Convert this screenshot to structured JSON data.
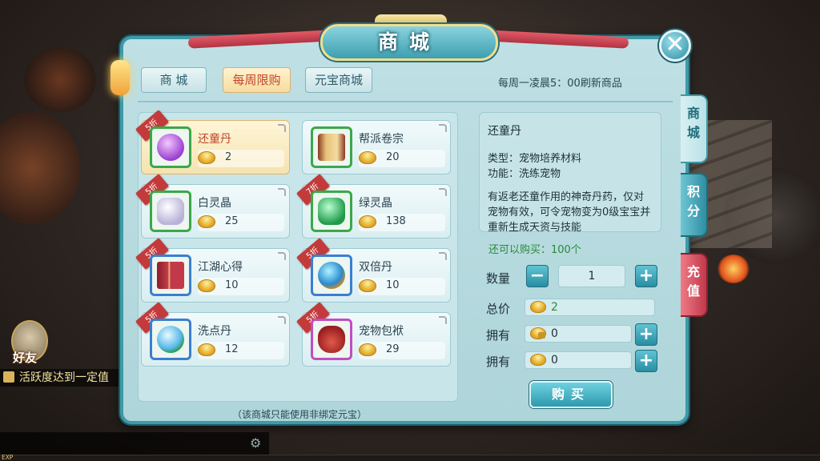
{
  "window": {
    "title": "商城",
    "close_symbol": "✕"
  },
  "tabs": [
    {
      "label": "商 城",
      "active": false
    },
    {
      "label": "每周限购",
      "active": true
    },
    {
      "label": "元宝商城",
      "active": false
    }
  ],
  "refresh_note": "每周一凌晨5：00刷新商品",
  "items": [
    {
      "name": "还童丹",
      "price": "2",
      "badge": "5折",
      "frame": "green",
      "icon": "purple-pill-icon",
      "selected": true
    },
    {
      "name": "帮派卷宗",
      "price": "20",
      "badge": "",
      "frame": "green",
      "icon": "scroll-icon",
      "selected": false
    },
    {
      "name": "白灵晶",
      "price": "25",
      "badge": "5折",
      "frame": "green",
      "icon": "white-crystal-icon",
      "selected": false
    },
    {
      "name": "绿灵晶",
      "price": "138",
      "badge": "7折",
      "frame": "green",
      "icon": "green-crystal-icon",
      "selected": false
    },
    {
      "name": "江湖心得",
      "price": "10",
      "badge": "5折",
      "frame": "blue",
      "icon": "book-icon",
      "selected": false
    },
    {
      "name": "双倍丹",
      "price": "10",
      "badge": "5折",
      "frame": "blue",
      "icon": "orb-icon",
      "selected": false
    },
    {
      "name": "洗点丹",
      "price": "12",
      "badge": "5折",
      "frame": "blue",
      "icon": "swirl-orb-icon",
      "selected": false
    },
    {
      "name": "宠物包袱",
      "price": "29",
      "badge": "5折",
      "frame": "purple",
      "icon": "bag-icon",
      "selected": false
    }
  ],
  "footer_note": "（该商城只能使用非绑定元宝）",
  "detail": {
    "title": "还童丹",
    "type_line": "类型：宠物培养材料",
    "func_line": "功能：洗练宠物",
    "description": "有返老还童作用的神奇丹药，仅对宠物有效，可令宠物变为0级宝宝并重新生成天资与技能"
  },
  "can_buy": "还可以购买：100个",
  "quantity": {
    "label": "数量",
    "value": "1",
    "minus": "−",
    "plus": "+"
  },
  "total": {
    "label": "总价",
    "value": "2"
  },
  "owned_bound": {
    "label": "拥有",
    "value": "0",
    "plus": "+"
  },
  "owned": {
    "label": "拥有",
    "value": "0",
    "plus": "+"
  },
  "buy_label": "购买",
  "side_tabs": {
    "shop": "商城",
    "points": "积分",
    "recharge": "充值"
  },
  "hud": {
    "friend_label": "好友",
    "activity_text": "活跃度达到一定值",
    "exp_label": "EXP"
  },
  "colors": {
    "panel": "#aed5da",
    "frame_border": "#3d9aa6",
    "accent_red": "#c2452c",
    "discount_badge": "#c43a3a"
  }
}
